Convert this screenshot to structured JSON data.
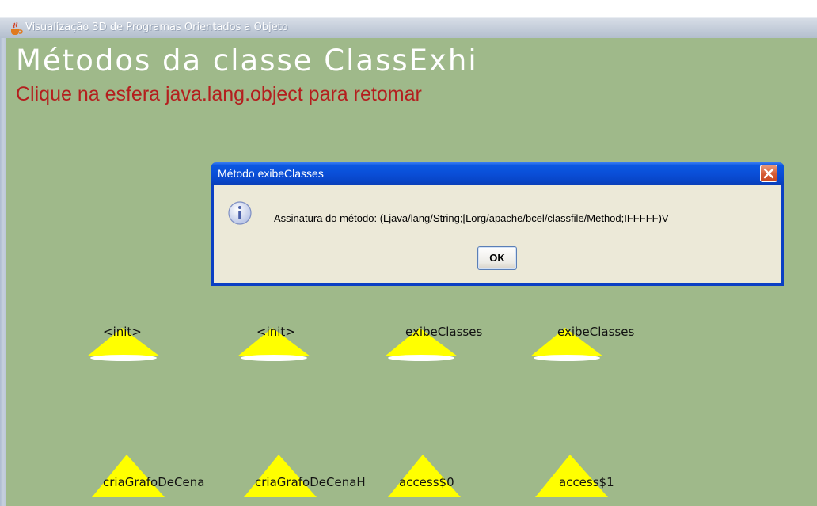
{
  "window": {
    "title": "Visualização 3D de Programas Orientados a Objeto",
    "icon": "java-cup-icon"
  },
  "scene": {
    "heading": "Métodos da classe ClassExhi",
    "subheading": "Clique na esfera java.lang.object para retomar",
    "background_color": "#9fb98a",
    "marker_color": "#ffff00",
    "methods_row1": [
      "<init>",
      "<init>",
      "exibeClasses",
      "exibeClasses"
    ],
    "methods_row2": [
      "criaGrafoDeCena",
      "criaGrafoDeCenaH",
      "access$0",
      "access$1"
    ]
  },
  "dialog": {
    "title": "Método exibeClasses",
    "message": "Assinatura do método: (Ljava/lang/String;[Lorg/apache/bcel/classfile/Method;IFFFFF)V",
    "ok_label": "OK",
    "icon": "info-icon",
    "close_icon": "close-icon",
    "titlebar_color": "#0a4fd8"
  }
}
